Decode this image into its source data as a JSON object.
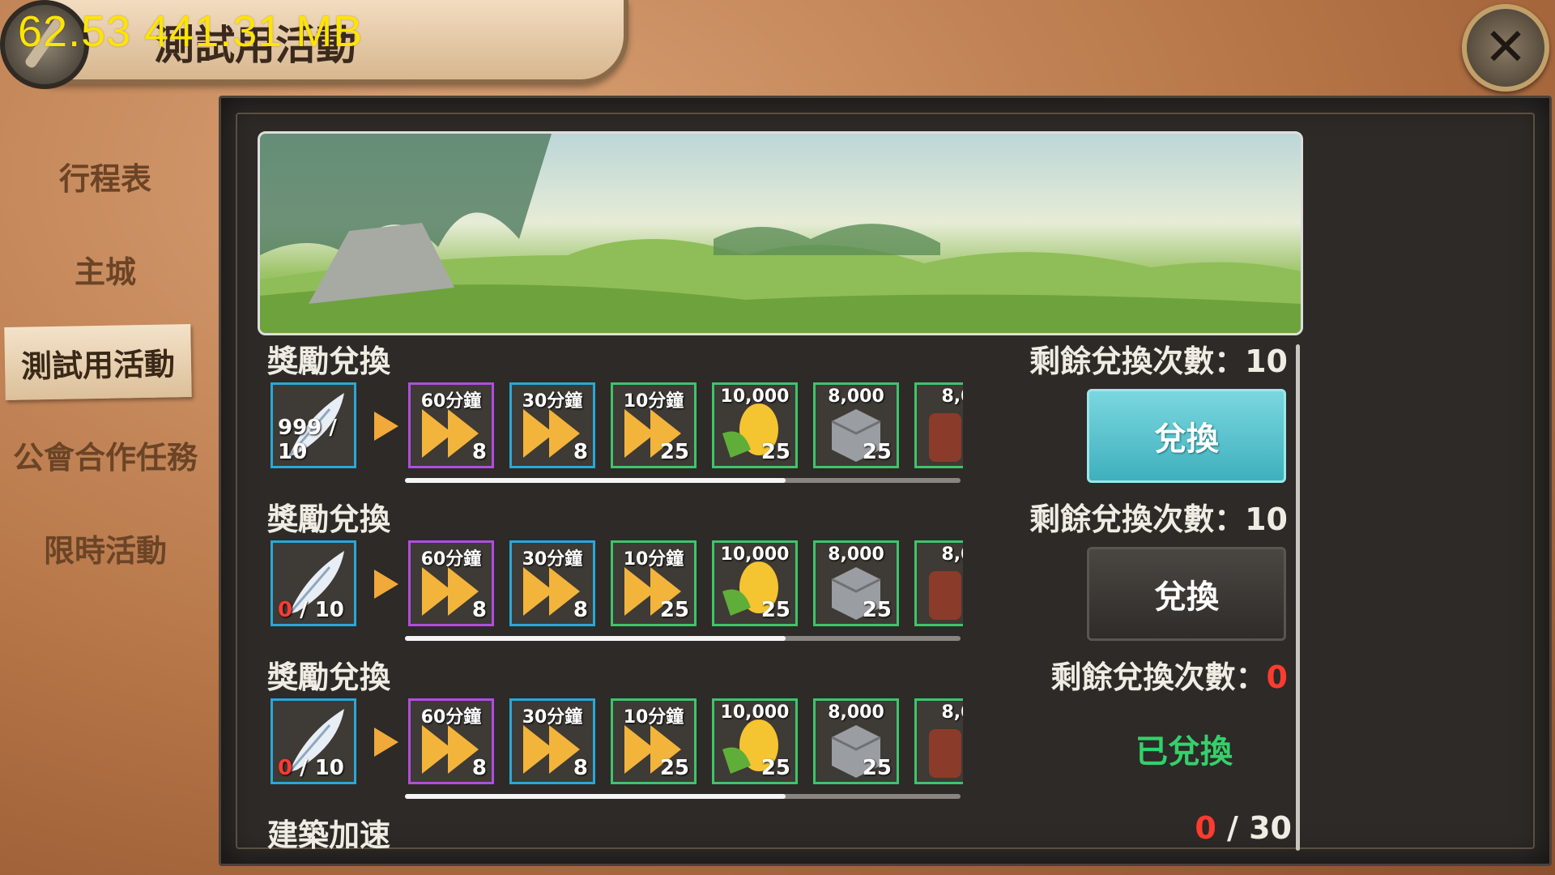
{
  "debug_overlay": "62.53 441.31 MB",
  "window": {
    "title": "測試用活動",
    "close_glyph": "✕"
  },
  "sidebar": {
    "items": [
      {
        "label": "行程表"
      },
      {
        "label": "主城"
      },
      {
        "label": "測試用活動",
        "active": true
      },
      {
        "label": "公會合作任務"
      },
      {
        "label": "限時活動"
      }
    ]
  },
  "exchanges": [
    {
      "title": "獎勵兌換",
      "cost_have": "999",
      "cost_need": "10",
      "remaining_label": "剩餘兌換次數：",
      "remaining": "10",
      "button": "兌換",
      "button_state": "active"
    },
    {
      "title": "獎勵兌換",
      "cost_have": "0",
      "cost_need": "10",
      "remaining_label": "剩餘兌換次數：",
      "remaining": "10",
      "button": "兌換",
      "button_state": "disabled"
    },
    {
      "title": "獎勵兌換",
      "cost_have": "0",
      "cost_need": "10",
      "remaining_label": "剩餘兌換次數：",
      "remaining": "0",
      "button": "已兌換",
      "button_state": "done"
    }
  ],
  "rewards": [
    {
      "label": "60分鐘",
      "qty": "8",
      "rarity": "purple",
      "icon": "speedup-icon"
    },
    {
      "label": "30分鐘",
      "qty": "8",
      "rarity": "blue",
      "icon": "speedup-icon"
    },
    {
      "label": "10分鐘",
      "qty": "25",
      "rarity": "green",
      "icon": "speedup-icon"
    },
    {
      "label": "10,000",
      "qty": "25",
      "rarity": "green",
      "icon": "corn-icon"
    },
    {
      "label": "8,000",
      "qty": "25",
      "rarity": "green",
      "icon": "stone-icon"
    },
    {
      "label": "8,0",
      "qty": "",
      "rarity": "green",
      "icon": "wood-icon"
    }
  ],
  "footer": {
    "title": "建築加速",
    "progress_have": "0",
    "progress_total": "30"
  },
  "colors": {
    "teal": "#3fb0bd",
    "done": "#35d06b",
    "red": "#ff3b30",
    "purple": "#b04de0",
    "blue": "#2aa7d8",
    "green": "#3ec46b"
  }
}
